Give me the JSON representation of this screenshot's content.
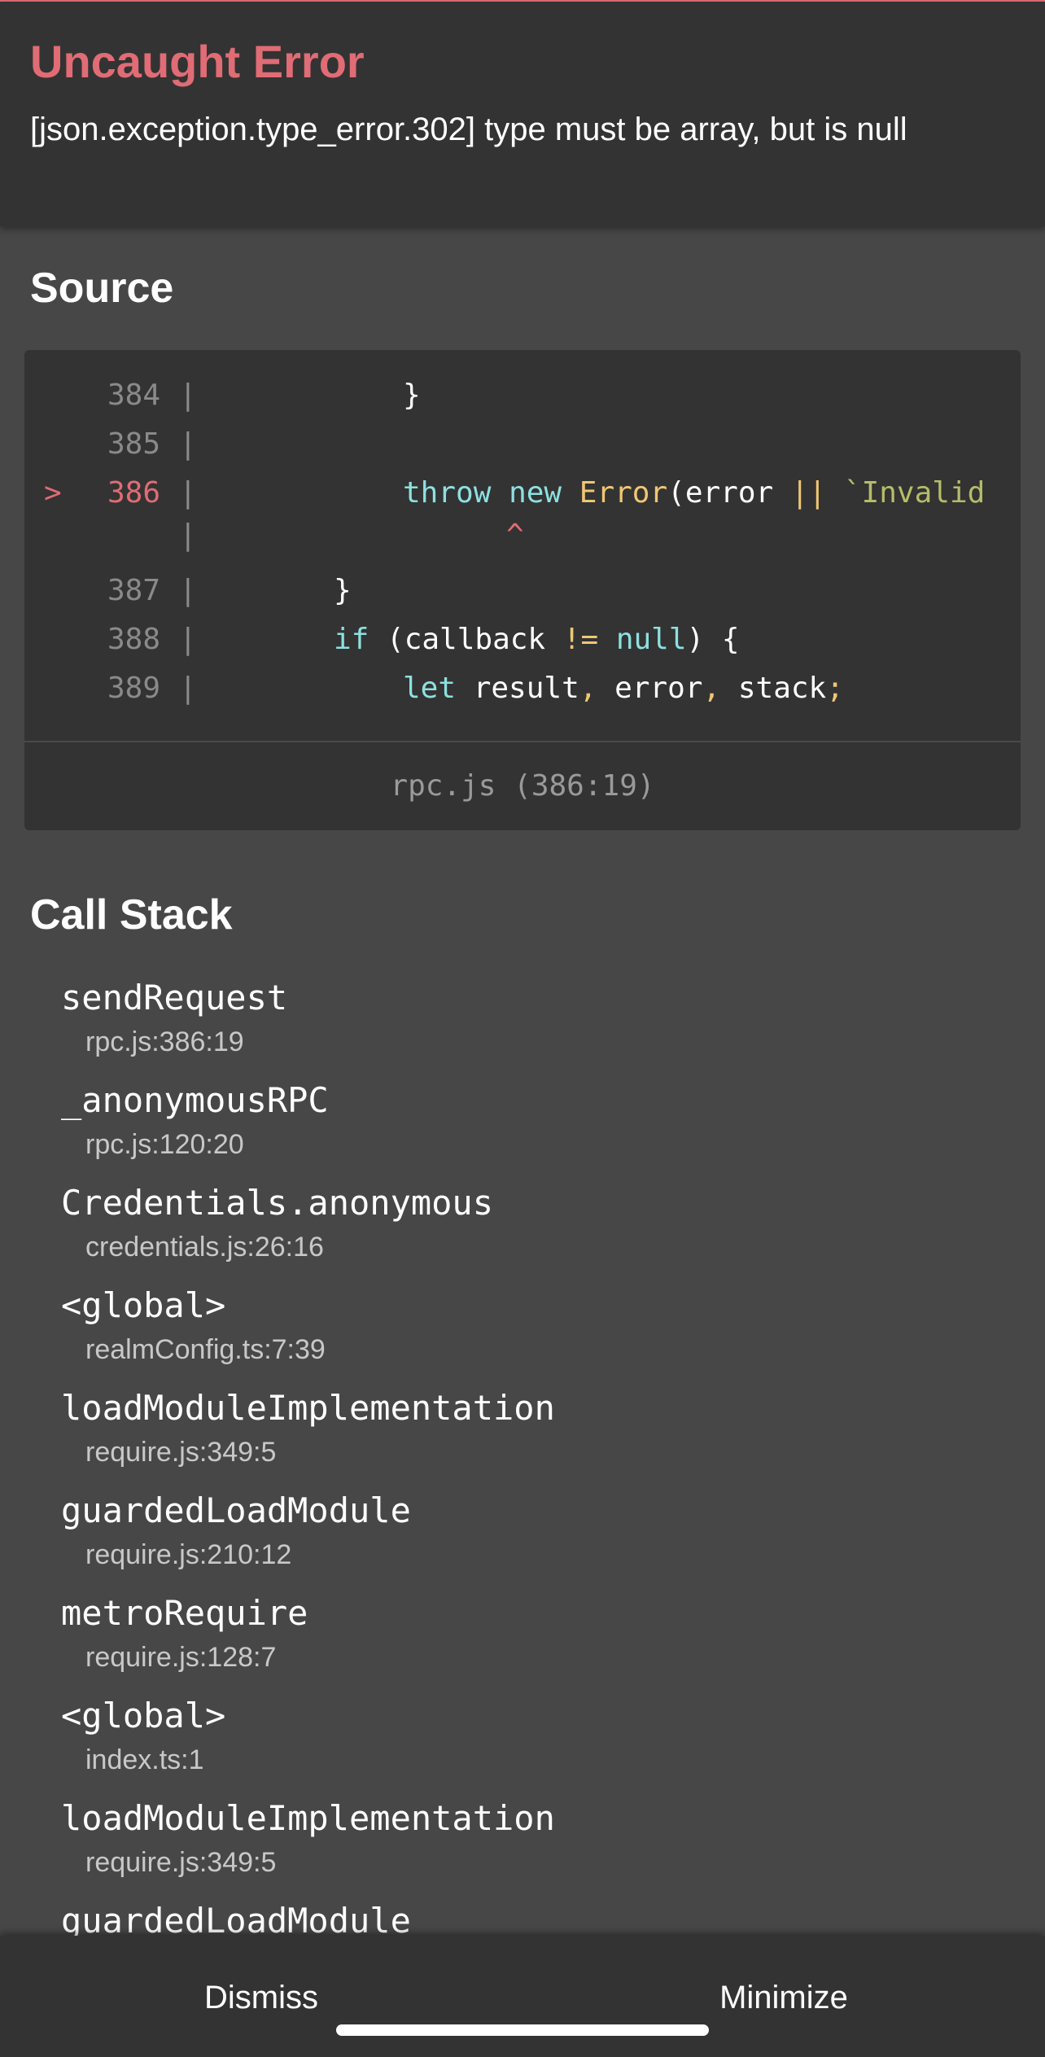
{
  "header": {
    "title": "Uncaught Error",
    "message": "[json.exception.type_error.302] type must be array, but is null"
  },
  "source": {
    "title": "Source",
    "marker": ">",
    "bar": "|",
    "lines": [
      {
        "num": "384",
        "code": "}"
      },
      {
        "num": "385",
        "code": ""
      },
      {
        "num": "386",
        "keyword1": "throw",
        "keyword2": "new",
        "fn": "Error",
        "paren": "(error ",
        "op": "||",
        "str": " `Invalid"
      },
      {
        "num": "",
        "caret": "^"
      },
      {
        "num": "387",
        "code": "}"
      },
      {
        "num": "388",
        "keyword1": "if",
        "text1": " (callback ",
        "op": "!=",
        "keyword2": " null",
        "text2": ") {"
      },
      {
        "num": "389",
        "keyword1": "let",
        "text1": " result",
        "comma1": ",",
        "text2": " error",
        "comma2": ",",
        "text3": " stack",
        "semi": ";"
      }
    ],
    "file_label": "rpc.js (386:19)"
  },
  "call_stack": {
    "title": "Call Stack",
    "frames": [
      {
        "name": "sendRequest",
        "location": "rpc.js:386:19"
      },
      {
        "name": "_anonymousRPC",
        "location": "rpc.js:120:20"
      },
      {
        "name": "Credentials.anonymous",
        "location": "credentials.js:26:16"
      },
      {
        "name": "<global>",
        "location": "realmConfig.ts:7:39"
      },
      {
        "name": "loadModuleImplementation",
        "location": "require.js:349:5"
      },
      {
        "name": "guardedLoadModule",
        "location": "require.js:210:12"
      },
      {
        "name": "metroRequire",
        "location": "require.js:128:7"
      },
      {
        "name": "<global>",
        "location": "index.ts:1"
      },
      {
        "name": "loadModuleImplementation",
        "location": "require.js:349:5"
      },
      {
        "name": "guardedLoadModule",
        "location": ""
      }
    ]
  },
  "footer": {
    "dismiss_label": "Dismiss",
    "minimize_label": "Minimize"
  }
}
